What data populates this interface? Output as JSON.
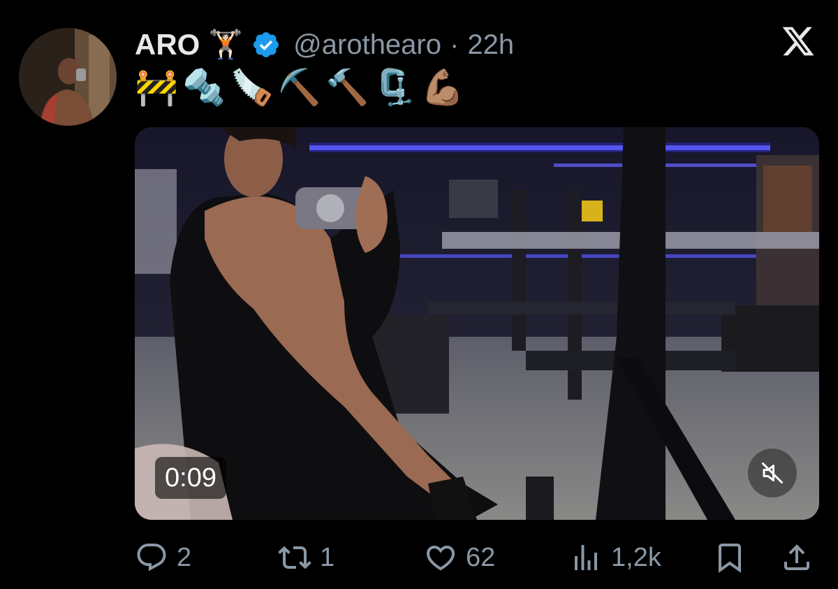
{
  "user": {
    "display_name": "ARO",
    "name_emoji": "🏋🏻",
    "handle": "@arothearo",
    "separator": "·",
    "time_ago": "22h",
    "verified_color": "#1d9bf0"
  },
  "tweet": {
    "text": "🚧🔩🪚⛏️🔨🗜️💪🏽"
  },
  "media": {
    "type": "video",
    "timestamp": "0:09",
    "muted": true
  },
  "actions": {
    "replies": "2",
    "reposts": "1",
    "likes": "62",
    "views": "1,2k"
  },
  "icons": [
    "x-logo-icon",
    "verified-badge-icon",
    "mute-icon",
    "reply-icon",
    "repost-icon",
    "like-icon",
    "views-icon",
    "bookmark-icon",
    "share-icon"
  ],
  "colors": {
    "background": "#000000",
    "text": "#e7e9ea",
    "secondary": "#8b98a5",
    "accent": "#1d9bf0"
  }
}
